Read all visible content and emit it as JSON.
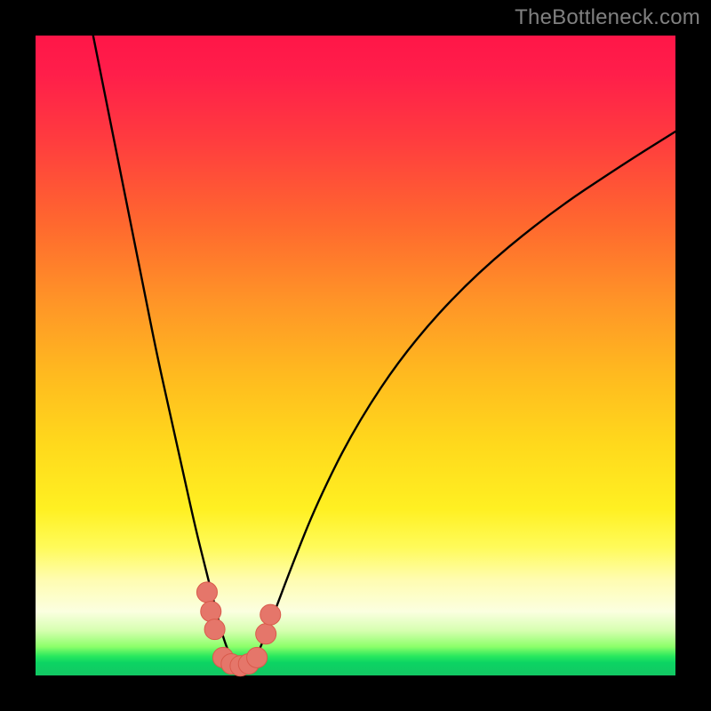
{
  "watermark": "TheBottleneck.com",
  "colors": {
    "page_bg": "#000000",
    "watermark": "#808080",
    "curve": "#000000",
    "marker_fill": "#e5766a",
    "marker_stroke": "#d95a4b"
  },
  "chart_data": {
    "type": "line",
    "title": "",
    "xlabel": "",
    "ylabel": "",
    "xlim": [
      0,
      100
    ],
    "ylim": [
      0,
      100
    ],
    "grid": false,
    "legend": false,
    "annotations": [],
    "series": [
      {
        "name": "bottleneck-curve",
        "x": [
          9,
          11,
          13,
          15,
          17,
          19,
          21,
          23,
          25,
          26.5,
          28,
          29,
          30,
          31,
          32,
          33,
          34,
          35,
          37,
          40,
          44,
          50,
          58,
          68,
          80,
          92,
          100
        ],
        "y": [
          100,
          90,
          80,
          70,
          60,
          50,
          41,
          32,
          23,
          17,
          11,
          7,
          4,
          2,
          1.2,
          1.2,
          2,
          4,
          9,
          17,
          27,
          39,
          51,
          62,
          72,
          80,
          85
        ]
      }
    ],
    "markers": [
      {
        "x": 26.8,
        "y": 13.0
      },
      {
        "x": 27.4,
        "y": 10.0
      },
      {
        "x": 28.0,
        "y": 7.2
      },
      {
        "x": 29.3,
        "y": 2.8
      },
      {
        "x": 30.6,
        "y": 1.8
      },
      {
        "x": 32.0,
        "y": 1.5
      },
      {
        "x": 33.3,
        "y": 1.8
      },
      {
        "x": 34.6,
        "y": 2.8
      },
      {
        "x": 36.0,
        "y": 6.5
      },
      {
        "x": 36.7,
        "y": 9.5
      }
    ],
    "marker_radius": 1.6
  }
}
